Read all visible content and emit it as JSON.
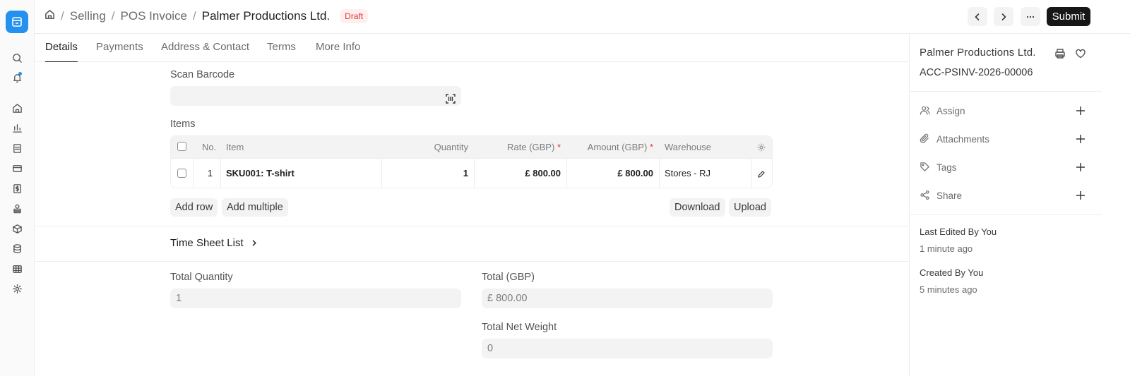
{
  "breadcrumb": {
    "items": [
      "Selling",
      "POS Invoice"
    ],
    "current": "Palmer Productions Ltd.",
    "status": "Draft"
  },
  "toolbar": {
    "submit_label": "Submit"
  },
  "tabs": [
    "Details",
    "Payments",
    "Address & Contact",
    "Terms",
    "More Info"
  ],
  "form": {
    "scan_barcode_label": "Scan Barcode",
    "scan_barcode_value": "",
    "items_label": "Items",
    "items_table": {
      "columns": [
        "No.",
        "Item",
        "Quantity",
        "Rate (GBP)",
        "Amount (GBP)",
        "Warehouse"
      ],
      "required_mark": "*",
      "rows": [
        {
          "no": "1",
          "item": "SKU001: T-shirt",
          "quantity": "1",
          "rate": "£ 800.00",
          "amount": "£ 800.00",
          "warehouse": "Stores - RJ"
        }
      ]
    },
    "add_row_label": "Add row",
    "add_multiple_label": "Add multiple",
    "download_label": "Download",
    "upload_label": "Upload",
    "time_sheet_section": "Time Sheet List",
    "total_quantity_label": "Total Quantity",
    "total_quantity_value": "1",
    "total_label": "Total (GBP)",
    "total_value": "£ 800.00",
    "total_net_weight_label": "Total Net Weight",
    "total_net_weight_value": "0"
  },
  "sidebar": {
    "title": "Palmer Productions Ltd.",
    "doc_id": "ACC-PSINV-2026-00006",
    "actions": [
      "Assign",
      "Attachments",
      "Tags",
      "Share"
    ],
    "last_edited_label": "Last Edited By You",
    "last_edited_time": "1 minute ago",
    "created_label": "Created By You",
    "created_time": "5 minutes ago"
  },
  "colors": {
    "accent": "#2490ef",
    "draft": "#e03636",
    "primary_button": "#171717"
  }
}
